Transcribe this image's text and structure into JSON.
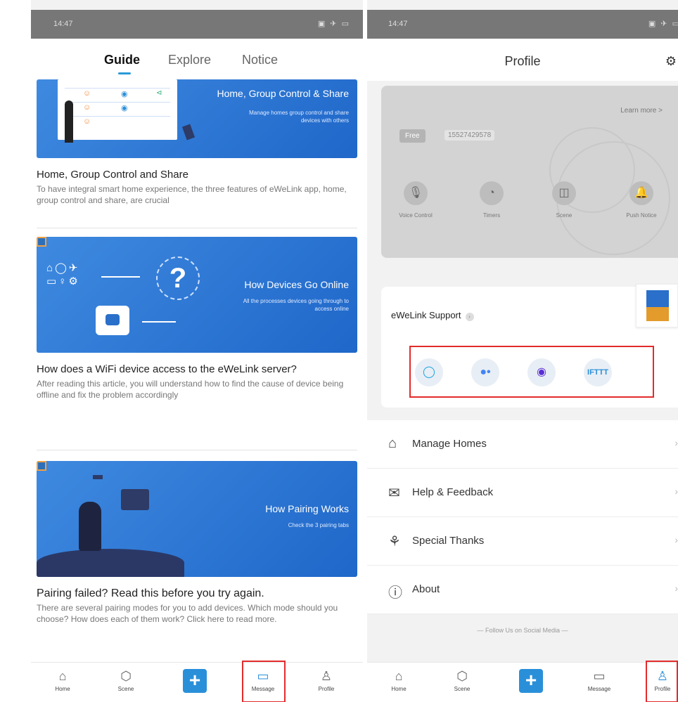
{
  "left": {
    "status": {
      "time": "14:47",
      "icons": "▣ ✈ ▭"
    },
    "tabs": [
      "Guide",
      "Explore",
      "Notice"
    ],
    "cards": [
      {
        "banner_title": "Home, Group Control & Share",
        "banner_sub": "Manage homes group control and share devices with others",
        "title": "Home, Group Control and Share",
        "desc": "To have integral smart home experience, the three features of eWeLink app, home, group control and share, are crucial"
      },
      {
        "banner_title": "How Devices Go Online",
        "banner_sub": "All the processes devices going through to access online",
        "title": "How does a WiFi device access to the eWeLink server?",
        "desc": "After reading this article, you will understand how to find the cause of device being offline and fix the problem accordingly"
      },
      {
        "banner_title": "How Pairing Works",
        "banner_sub": "Check the 3 pairing tabs",
        "title": "Pairing failed? Read this before you try again.",
        "desc": "There are several pairing modes for you to add devices. Which mode should you choose? How does each of them work? Click here to read more."
      }
    ],
    "nav": [
      "Home",
      "Scene",
      "",
      "Message",
      "Profile"
    ]
  },
  "right": {
    "status": {
      "time": "14:47",
      "icons": "▣ ✈ ▭"
    },
    "title": "Profile",
    "vip": {
      "learn_more": "Learn more >",
      "plan": "Free",
      "phone": "15527429578",
      "features": [
        "Voice Control",
        "Timers",
        "Scene",
        "Push Notice"
      ]
    },
    "support": {
      "label": "eWeLink Support",
      "assistants": [
        "Alexa",
        "Google Assistant",
        "Cortana",
        "IFTTT"
      ],
      "ifttt": "IFTTT"
    },
    "menu": [
      "Manage Homes",
      "Help & Feedback",
      "Special Thanks",
      "About"
    ],
    "follow": "Follow Us on Social Media",
    "nav": [
      "Home",
      "Scene",
      "",
      "Message",
      "Profile"
    ]
  }
}
